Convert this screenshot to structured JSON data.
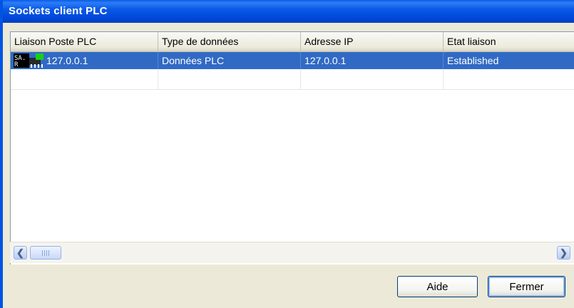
{
  "window": {
    "title": "Sockets client PLC"
  },
  "table": {
    "columns": [
      "Liaison Poste PLC",
      "Type de données",
      "Adresse IP",
      "Etat liaison"
    ],
    "rows": [
      {
        "liaison": "127.0.0.1",
        "type": "Données PLC",
        "ip": "127.0.0.1",
        "etat": "Established",
        "selected": true
      }
    ]
  },
  "icons": {
    "connection": "plc-connection-icon",
    "scroll_left": "arrow-left-icon",
    "scroll_right": "arrow-right-icon"
  },
  "buttons": {
    "help": "Aide",
    "close": "Fermer"
  },
  "colors": {
    "titlebar": "#0a5ae8",
    "selection": "#316ac5",
    "face": "#ece9d8"
  }
}
